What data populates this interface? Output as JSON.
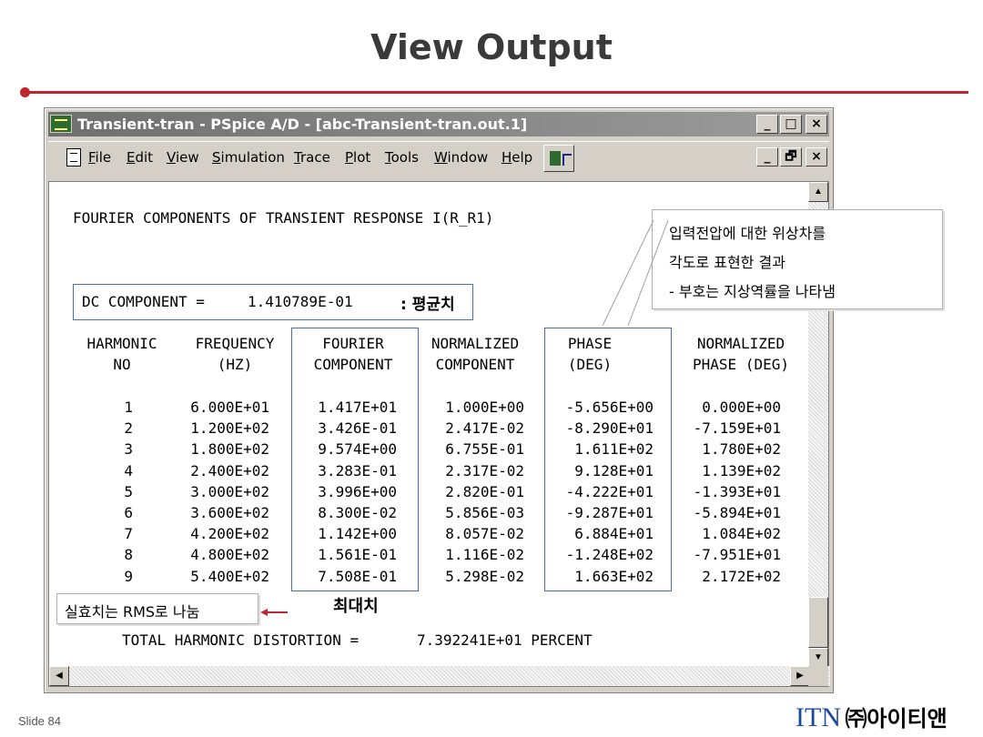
{
  "slide": {
    "title": "View Output",
    "footer_left": "Slide 84",
    "logo_text": "ITN",
    "logo_company": "㈜아이티앤"
  },
  "window": {
    "title": "Transient-tran - PSpice A/D  - [abc-Transient-tran.out.1]",
    "outer_controls": [
      "_",
      "□",
      "×"
    ],
    "inner_controls": [
      "_",
      "🗗",
      "×"
    ],
    "menu": [
      "File",
      "Edit",
      "View",
      "Simulation",
      "Trace",
      "Plot",
      "Tools",
      "Window",
      "Help"
    ]
  },
  "output": {
    "heading": "FOURIER COMPONENTS OF TRANSIENT RESPONSE I(R_R1)",
    "dc_label": "DC COMPONENT =",
    "dc_value": "1.410789E-01",
    "columns": [
      {
        "line1": "HARMONIC",
        "line2": "NO"
      },
      {
        "line1": "FREQUENCY",
        "line2": "(HZ)"
      },
      {
        "line1": "FOURIER",
        "line2": "COMPONENT"
      },
      {
        "line1": "NORMALIZED",
        "line2": "COMPONENT"
      },
      {
        "line1": "PHASE",
        "line2": "(DEG)"
      },
      {
        "line1": "NORMALIZED",
        "line2": "PHASE (DEG)"
      }
    ],
    "rows": [
      [
        "1",
        "6.000E+01",
        "1.417E+01",
        "1.000E+00",
        "-5.656E+00",
        "0.000E+00"
      ],
      [
        "2",
        "1.200E+02",
        "3.426E-01",
        "2.417E-02",
        "-8.290E+01",
        "-7.159E+01"
      ],
      [
        "3",
        "1.800E+02",
        "9.574E+00",
        "6.755E-01",
        "1.611E+02",
        "1.780E+02"
      ],
      [
        "4",
        "2.400E+02",
        "3.283E-01",
        "2.317E-02",
        "9.128E+01",
        "1.139E+02"
      ],
      [
        "5",
        "3.000E+02",
        "3.996E+00",
        "2.820E-01",
        "-4.222E+01",
        "-1.393E+01"
      ],
      [
        "6",
        "3.600E+02",
        "8.300E-02",
        "5.856E-03",
        "-9.287E+01",
        "-5.894E+01"
      ],
      [
        "7",
        "4.200E+02",
        "1.142E+00",
        "8.057E-02",
        "6.884E+01",
        "1.084E+02"
      ],
      [
        "8",
        "4.800E+02",
        "1.561E-01",
        "1.116E-02",
        "-1.248E+02",
        "-7.951E+01"
      ],
      [
        "9",
        "5.400E+02",
        "7.508E-01",
        "5.298E-02",
        "1.663E+02",
        "2.172E+02"
      ]
    ],
    "thd_label": "TOTAL HARMONIC DISTORTION =",
    "thd_value": "7.392241E+01 PERCENT"
  },
  "annotations": {
    "dc_note": ": 평균치",
    "max_note": "최대치",
    "rms_note": "실효치는 RMS로 나눔",
    "phase_note": [
      "입력전압에 대한 위상차를",
      "각도로 표현한 결과",
      "- 부호는 지상역률을 나타냄"
    ]
  }
}
